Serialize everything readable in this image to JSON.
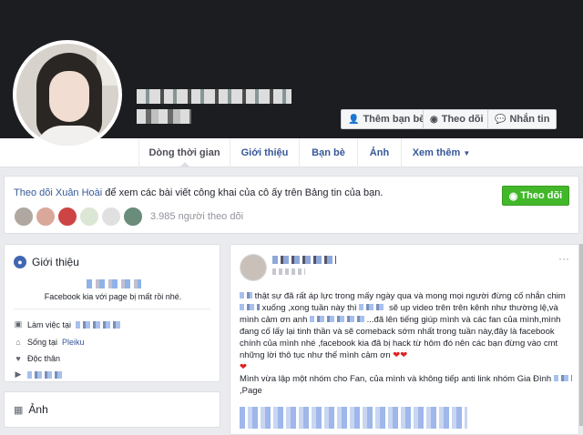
{
  "profile": {
    "buttons": {
      "add_friend": "Thêm bạn bè",
      "follow": "Theo dõi",
      "message": "Nhắn tin"
    }
  },
  "tabs": [
    "Dòng thời gian",
    "Giới thiệu",
    "Bạn bè",
    "Ảnh",
    "Xem thêm"
  ],
  "follow_card": {
    "link": "Theo dõi Xuân Hoài",
    "text": " để xem các bài viết công khai của cô ấy trên Bảng tin của bạn.",
    "button": "Theo dõi",
    "followers": "3.985 người theo dõi"
  },
  "intro": {
    "title": "Giới thiệu",
    "bio": "Facebook kia với page bị mất rồi nhé.",
    "work_label": "Làm việc tại",
    "lives_label": "Sống tại",
    "lives_place": "Pleiku",
    "relationship": "Độc thân"
  },
  "photos": {
    "title": "Ảnh"
  },
  "post": {
    "line1": "thật sự đã rất áp lực trong mấy ngày qua và mong mọi người đừng cố nhắn chim",
    "line2": "xuống ,xong tuần này thì",
    "line3": "sẽ up video trên trên kênh như thường lệ,và mình cảm ơn anh",
    "line4": "...đã lên tiếng giúp mình và các fan của mình,mình đang cố lấy lại tinh thần và sẽ comeback sớm nhất trong tuần này,đây là facebook chính của mình nhé ,facebook kia đã bị hack từ hôm đó nên các bạn đừng vào cmt những lời thô tục như thế mình cảm ơn",
    "line5": "Mình vừa lập một nhóm cho Fan, của mình và không tiếp anti link nhóm Gia Đình",
    "line6": ",Page"
  },
  "colors": {
    "link": "#365899",
    "green": "#42b72a",
    "cover": "#1c1d20"
  }
}
